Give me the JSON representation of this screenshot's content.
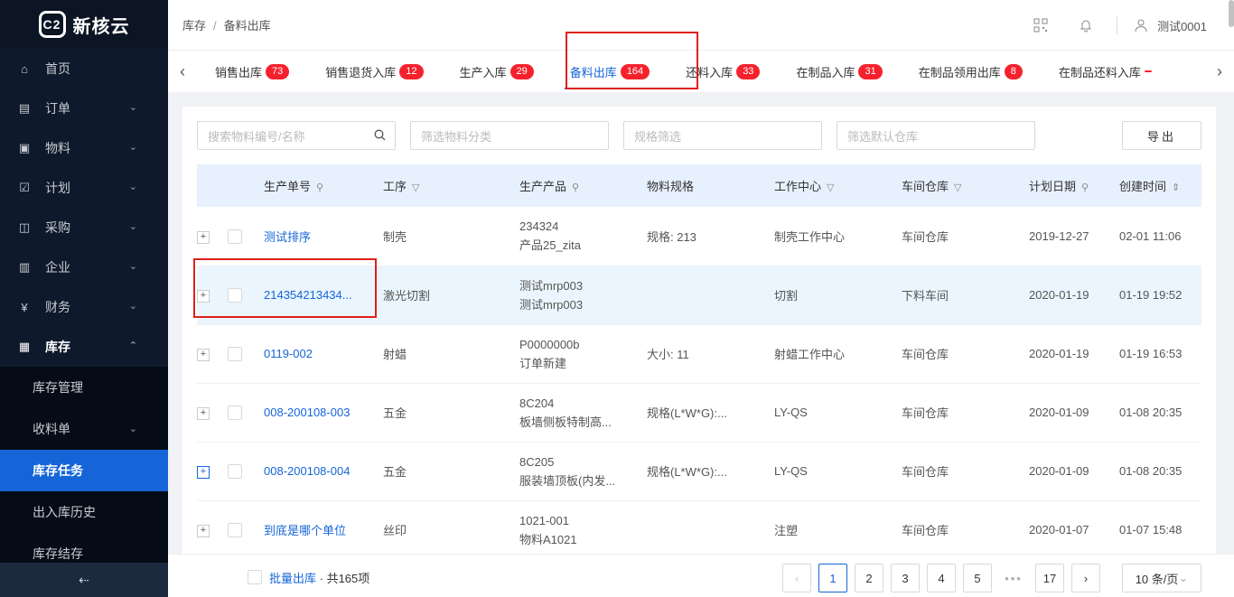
{
  "brand": {
    "logo_text": "新核云",
    "logo_mark": "C2"
  },
  "sidebar": {
    "items": [
      {
        "label": "首页",
        "icon": "home-icon",
        "glyph": "⌂"
      },
      {
        "label": "订单",
        "icon": "order-icon",
        "glyph": "▤"
      },
      {
        "label": "物料",
        "icon": "box-icon",
        "glyph": "▣"
      },
      {
        "label": "计划",
        "icon": "calendar-check-icon",
        "glyph": "☑"
      },
      {
        "label": "采购",
        "icon": "shopping-bag-icon",
        "glyph": "◫"
      },
      {
        "label": "企业",
        "icon": "chart-icon",
        "glyph": "▥"
      },
      {
        "label": "财务",
        "icon": "yen-icon",
        "glyph": "¥"
      },
      {
        "label": "库存",
        "icon": "warehouse-icon",
        "glyph": "▦"
      }
    ],
    "sub_items": [
      {
        "label": "库存管理"
      },
      {
        "label": "收料单"
      },
      {
        "label": "库存任务"
      },
      {
        "label": "出入库历史"
      },
      {
        "label": "库存结存"
      }
    ],
    "collapse_glyph": "⇠"
  },
  "header": {
    "breadcrumb": [
      "库存",
      "备料出库"
    ],
    "breadcrumb_sep": "/",
    "user_name": "测试0001"
  },
  "tabs": [
    {
      "label": "销售出库",
      "count": "73"
    },
    {
      "label": "销售退货入库",
      "count": "12"
    },
    {
      "label": "生产入库",
      "count": "29"
    },
    {
      "label": "备料出库",
      "count": "164"
    },
    {
      "label": "还料入库",
      "count": "33"
    },
    {
      "label": "在制品入库",
      "count": "31"
    },
    {
      "label": "在制品领用出库",
      "count": "8"
    },
    {
      "label": "在制品还料入库",
      "count": ""
    }
  ],
  "filters": {
    "search_placeholder": "搜索物料编号/名称",
    "category_placeholder": "筛选物料分类",
    "spec_placeholder": "规格筛选",
    "warehouse_placeholder": "筛选默认仓库",
    "export_label": "导出"
  },
  "table": {
    "columns": [
      "生产单号",
      "工序",
      "生产产品",
      "物料规格",
      "工作中心",
      "车间仓库",
      "计划日期",
      "创建时间"
    ],
    "rows": [
      {
        "order": "测试排序",
        "process": "制壳",
        "product_code": "234324",
        "product_name": "产品25_zita",
        "spec": "规格: 213",
        "center": "制壳工作中心",
        "warehouse": "车间仓库",
        "plan_date": "2019-12-27",
        "created": "02-01 11:06"
      },
      {
        "order": "214354213434...",
        "process": "激光切割",
        "product_code": "测试mrp003",
        "product_name": "测试mrp003",
        "spec": "",
        "center": "切割",
        "warehouse": "下料车间",
        "plan_date": "2020-01-19",
        "created": "01-19 19:52"
      },
      {
        "order": "0119-002",
        "process": "射蜡",
        "product_code": "P0000000b",
        "product_name": "订单新建",
        "spec": "大小: 11",
        "center": "射蜡工作中心",
        "warehouse": "车间仓库",
        "plan_date": "2020-01-19",
        "created": "01-19 16:53"
      },
      {
        "order": "008-200108-003",
        "process": "五金",
        "product_code": "8C204",
        "product_name": "板墙侧板特制高...",
        "spec": "规格(L*W*G):...",
        "center": "LY-QS",
        "warehouse": "车间仓库",
        "plan_date": "2020-01-09",
        "created": "01-08 20:35"
      },
      {
        "order": "008-200108-004",
        "process": "五金",
        "product_code": "8C205",
        "product_name": "服装墙顶板(内发...",
        "spec": "规格(L*W*G):...",
        "center": "LY-QS",
        "warehouse": "车间仓库",
        "plan_date": "2020-01-09",
        "created": "01-08 20:35"
      },
      {
        "order": "到底是哪个单位",
        "process": "丝印",
        "product_code": "1021-001",
        "product_name": "物料A1021",
        "spec": "",
        "center": "注塑",
        "warehouse": "车间仓库",
        "plan_date": "2020-01-07",
        "created": "01-07 15:48"
      }
    ]
  },
  "footer": {
    "batch_label": "批量出库",
    "total_text": "· 共165项",
    "pages": [
      "1",
      "2",
      "3",
      "4",
      "5"
    ],
    "last_page": "17",
    "ellipsis": "•••",
    "page_size": "10 条/页"
  },
  "colors": {
    "accent": "#1565d8",
    "badge": "#f5222d",
    "sidebar_bg": "#0e1a2b",
    "highlight_box": "#e0201b"
  }
}
